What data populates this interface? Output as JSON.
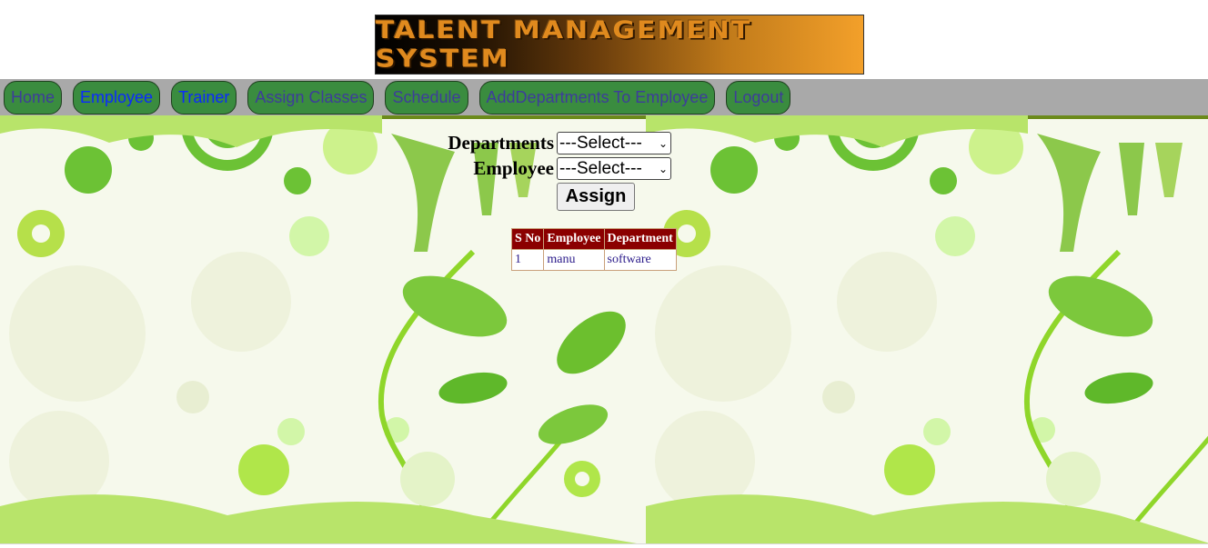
{
  "banner": {
    "title": "TALENT MANAGEMENT SYSTEM"
  },
  "nav": {
    "items": [
      {
        "label": "Home"
      },
      {
        "label": "Employee"
      },
      {
        "label": "Trainer"
      },
      {
        "label": "Assign Classes"
      },
      {
        "label": "Schedule"
      },
      {
        "label": "AddDepartments To Employee"
      },
      {
        "label": "Logout"
      }
    ]
  },
  "form": {
    "departments_label": "Departments",
    "departments_value": "---Select---",
    "employee_label": "Employee",
    "employee_value": "---Select---",
    "assign_label": "Assign"
  },
  "table": {
    "headers": [
      "S No",
      "Employee",
      "Department"
    ],
    "rows": [
      [
        "1",
        "manu",
        "software"
      ]
    ]
  },
  "colors": {
    "nav_bar": "#a9a9a9",
    "nav_button": "#3a8c3f",
    "table_header": "#8b0000"
  }
}
